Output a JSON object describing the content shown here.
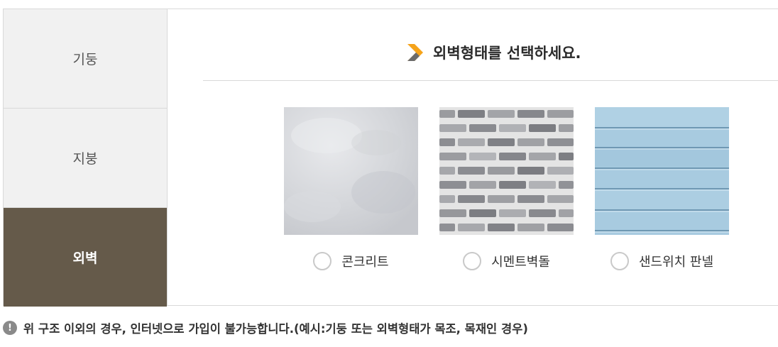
{
  "sidebar": {
    "items": [
      {
        "label": "기둥"
      },
      {
        "label": "지붕"
      },
      {
        "label": "외벽"
      }
    ],
    "active": "외벽"
  },
  "main": {
    "title": "외벽형태를 선택하세요.",
    "accent_color": "#f5a31a",
    "options": [
      {
        "label": "콘크리트"
      },
      {
        "label": "시멘트벽돌"
      },
      {
        "label": "샌드위치 판넬"
      }
    ]
  },
  "notice": {
    "icon": "info-icon",
    "text": "위 구조 이외의 경우, 인터넷으로 가입이 불가능합니다.(예시:기둥 또는 외벽형태가 목조, 목재인 경우)"
  },
  "colors": {
    "sidebar_active_bg": "#655a4a",
    "sidebar_bg": "#f1f1f1"
  }
}
